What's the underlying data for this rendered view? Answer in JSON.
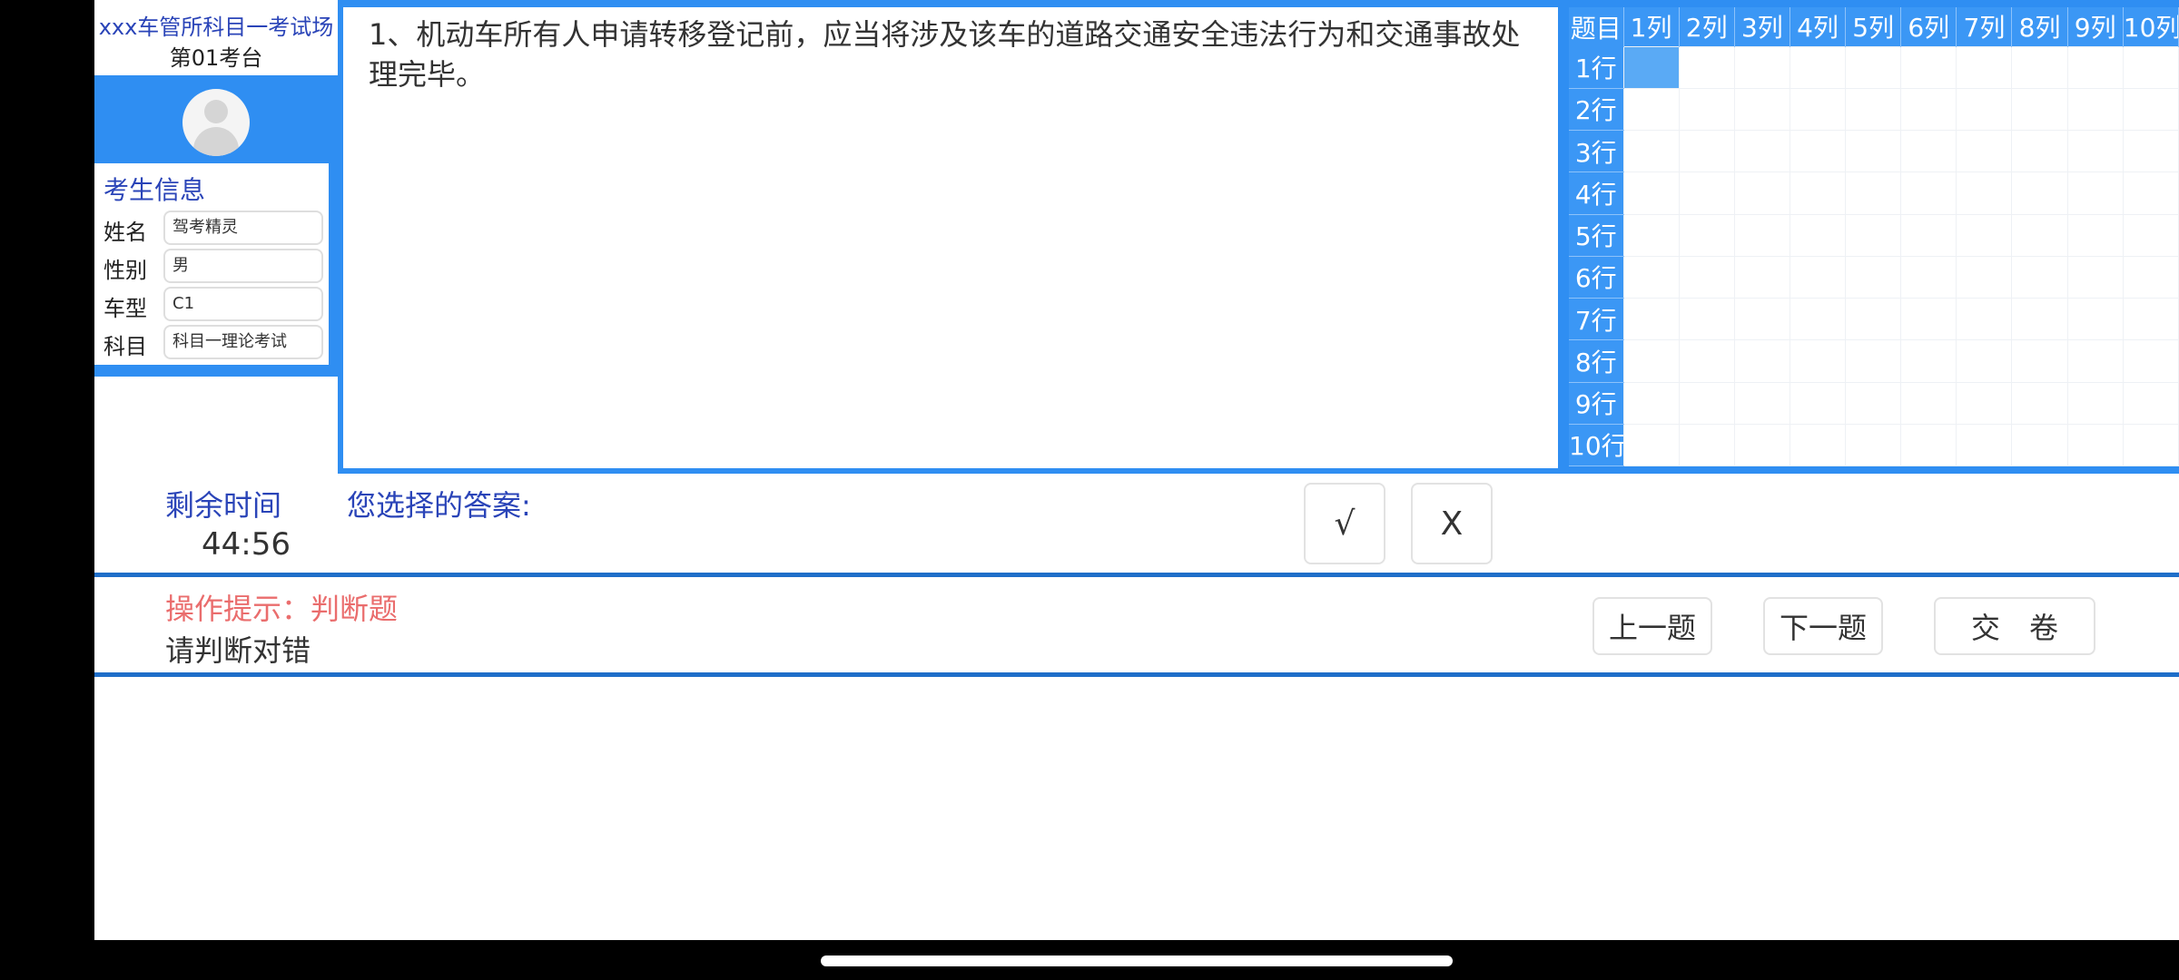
{
  "header": {
    "exam_hall": "xxx车管所科目一考试场",
    "exam_seat": "第01考台"
  },
  "candidate": {
    "section_title": "考生信息",
    "fields": [
      {
        "label": "姓名",
        "value": "驾考精灵"
      },
      {
        "label": "性别",
        "value": "男"
      },
      {
        "label": "车型",
        "value": "C1"
      },
      {
        "label": "科目",
        "value": "科目一理论考试"
      }
    ]
  },
  "question": {
    "text": "1、机动车所有人申请转移登记前，应当将涉及该车的道路交通安全违法行为和交通事故处理完毕。"
  },
  "grid": {
    "corner": "题目",
    "columns": [
      "1列",
      "2列",
      "3列",
      "4列",
      "5列",
      "6列",
      "7列",
      "8列",
      "9列",
      "10列"
    ],
    "rows": [
      "1行",
      "2行",
      "3行",
      "4行",
      "5行",
      "6行",
      "7行",
      "8行",
      "9行",
      "10行"
    ],
    "current": {
      "row": 1,
      "col": 1
    }
  },
  "timer": {
    "label": "剩余时间",
    "value": "44:56"
  },
  "answer": {
    "label": "您选择的答案:",
    "selected": "",
    "options": [
      "√",
      "X"
    ]
  },
  "tips": {
    "title": "操作提示：判断题",
    "text": "请判断对错"
  },
  "nav": {
    "prev": "上一题",
    "next": "下一题",
    "submit": "交　卷"
  },
  "colors": {
    "accent_blue": "#2f8ef2",
    "title_blue": "#2a44b8",
    "divider_blue": "#1f6ec9",
    "tip_red": "#ea6d6d",
    "current_cell": "#5aaaf5"
  },
  "icons": {
    "avatar": "user-avatar-icon"
  }
}
